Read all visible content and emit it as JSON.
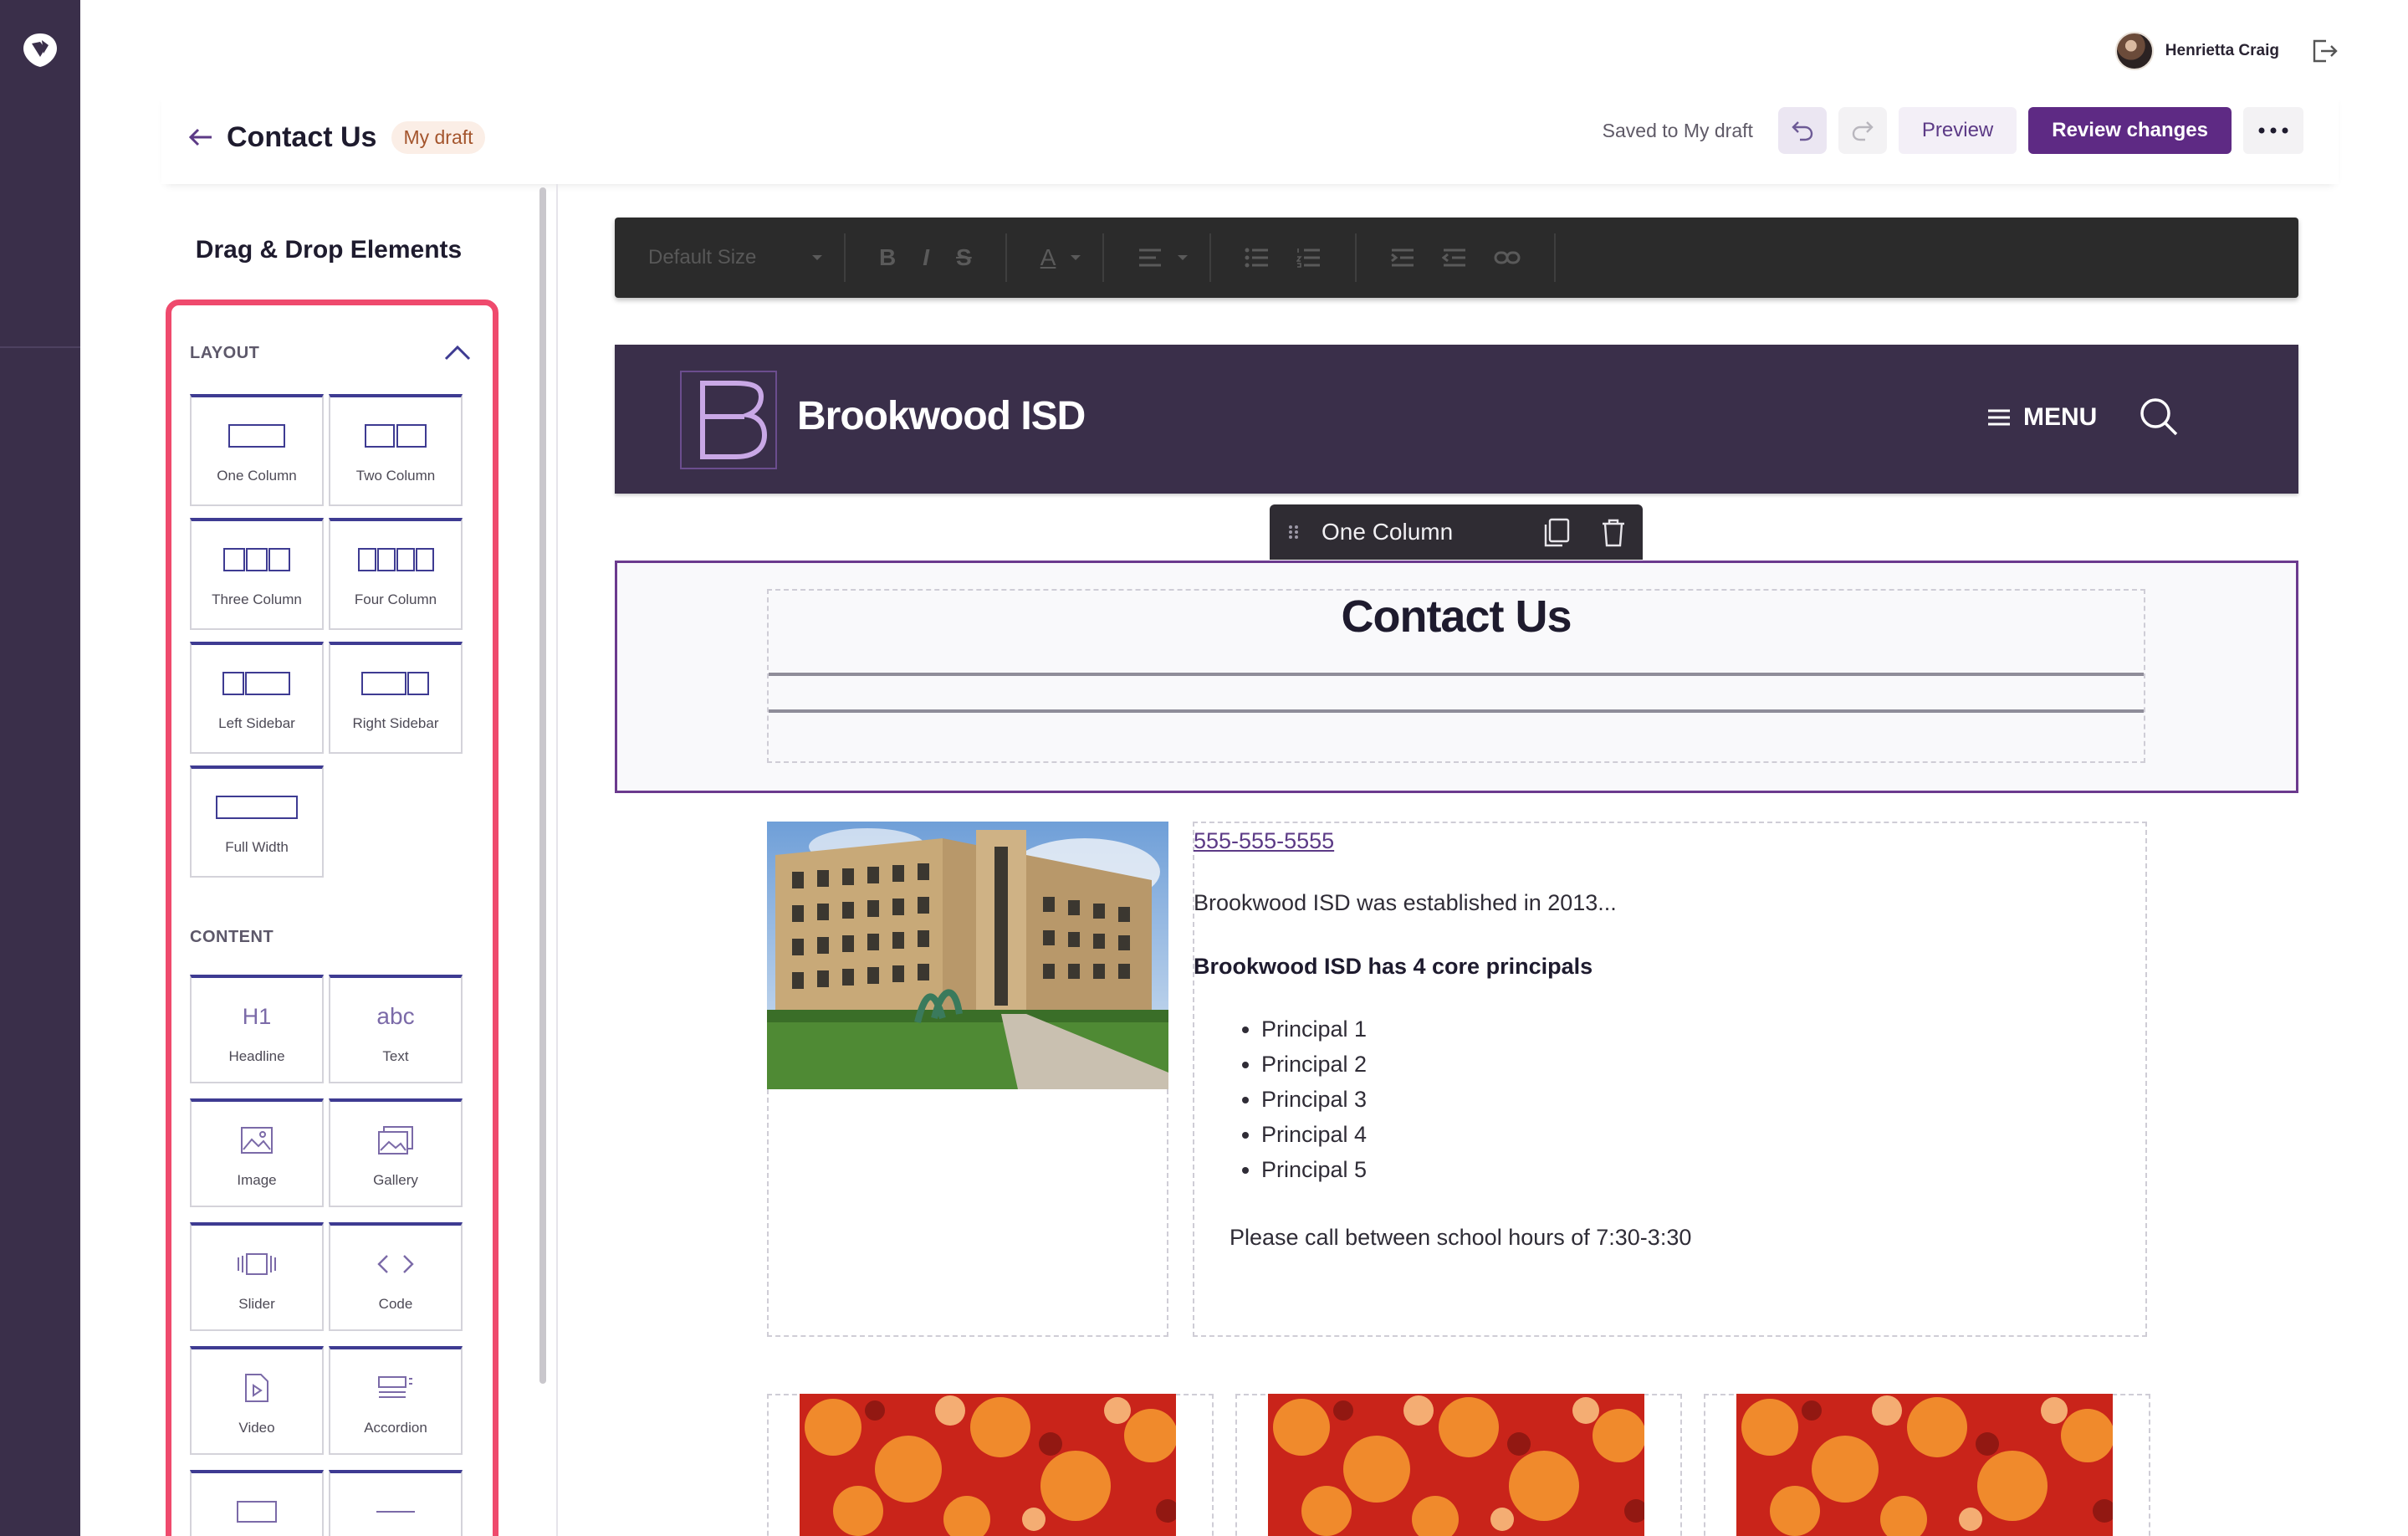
{
  "user": {
    "name": "Henrietta Craig"
  },
  "header": {
    "title": "Contact Us",
    "badge": "My draft",
    "saved_status": "Saved to My draft",
    "preview_label": "Preview",
    "review_label": "Review changes"
  },
  "panel": {
    "title": "Drag & Drop Elements",
    "layout_label": "LAYOUT",
    "content_label": "CONTENT",
    "layout_items": [
      {
        "label": "One Column",
        "icon": "one-column-icon"
      },
      {
        "label": "Two Column",
        "icon": "two-column-icon"
      },
      {
        "label": "Three Column",
        "icon": "three-column-icon"
      },
      {
        "label": "Four Column",
        "icon": "four-column-icon"
      },
      {
        "label": "Left Sidebar",
        "icon": "left-sidebar-icon"
      },
      {
        "label": "Right Sidebar",
        "icon": "right-sidebar-icon"
      },
      {
        "label": "Full Width",
        "icon": "full-width-icon"
      }
    ],
    "content_items": [
      {
        "label": "Headline",
        "glyph": "H1",
        "icon": "headline-icon"
      },
      {
        "label": "Text",
        "glyph": "abc",
        "icon": "text-icon"
      },
      {
        "label": "Image",
        "icon": "image-icon"
      },
      {
        "label": "Gallery",
        "icon": "gallery-icon"
      },
      {
        "label": "Slider",
        "icon": "slider-icon"
      },
      {
        "label": "Code",
        "icon": "code-icon"
      },
      {
        "label": "Video",
        "icon": "video-icon"
      },
      {
        "label": "Accordion",
        "icon": "accordion-icon"
      }
    ]
  },
  "toolbar": {
    "font_size": "Default Size",
    "bold": "B",
    "italic": "I",
    "strike": "S",
    "color": "A"
  },
  "site": {
    "logo_letter": "B",
    "name": "Brookwood ISD",
    "menu_label": "MENU"
  },
  "block": {
    "label": "One Column",
    "heading": "Contact Us"
  },
  "content": {
    "phone": "555-555-5555",
    "established": "Brookwood ISD was established in 2013...",
    "principals_heading": "Brookwood ISD has 4 core principals",
    "principals": [
      "Principal 1",
      "Principal 2",
      "Principal 3",
      "Principal 4",
      "Principal 5"
    ],
    "call_note": "Please call between school hours of 7:30-3:30"
  },
  "colors": {
    "rail": "#3a2f4a",
    "accent": "#5e2a84",
    "panel_border": "#ef4a6d",
    "tile_top": "#3e3b92"
  }
}
